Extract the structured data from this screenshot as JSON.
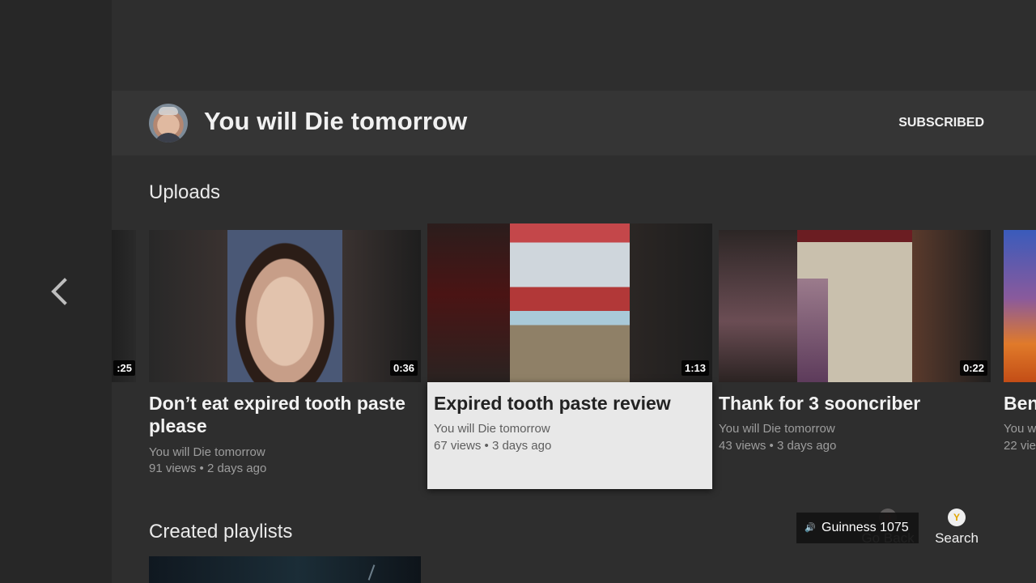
{
  "channel": {
    "name": "You will Die tomorrow",
    "subscribe_label": "SUBSCRIBED"
  },
  "uploads": {
    "title": "Uploads",
    "partial_left_duration": ":25",
    "videos": [
      {
        "title": "Don’t eat expired tooth paste please",
        "author": "You will Die tomorrow",
        "stats": "91 views • 2 days ago",
        "duration": "0:36"
      },
      {
        "title": "Expired tooth paste review",
        "author": "You will Die tomorrow",
        "stats": "67 views • 3 days ago",
        "duration": "1:13"
      },
      {
        "title": "Thank for 3 sooncriber",
        "author": "You will Die tomorrow",
        "stats": "43 views • 3 days ago",
        "duration": "0:22"
      },
      {
        "title": "Ben",
        "author": "You w",
        "stats": "22 vie",
        "duration": ""
      }
    ]
  },
  "playlists": {
    "title": "Created playlists"
  },
  "controls": {
    "back_hint": "Go Back",
    "back_button_glyph": "B",
    "search_hint": "Search",
    "search_button_glyph": "Y"
  },
  "toast": {
    "text": "Guinness 1075",
    "icon": "speaker-icon"
  },
  "colors": {
    "background": "#2e2e2e",
    "sidebar": "#272727",
    "selected_card": "#e8e8e8"
  }
}
